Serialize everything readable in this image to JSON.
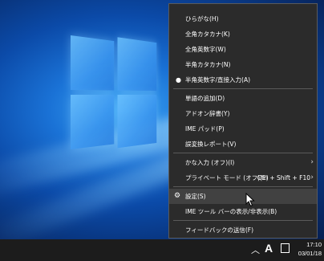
{
  "menu": {
    "items": [
      {
        "label": "ひらがな(H)"
      },
      {
        "label": "全角カタカナ(K)"
      },
      {
        "label": "全角英数字(W)"
      },
      {
        "label": "半角カタカナ(N)"
      },
      {
        "label": "半角英数字/直接入力(A)",
        "selected": true
      },
      {
        "label": "単語の追加(D)"
      },
      {
        "label": "アドオン辞書(Y)"
      },
      {
        "label": "IME パッド(P)"
      },
      {
        "label": "誤変換レポート(V)"
      },
      {
        "label": "かな入力 (オフ)(I)"
      },
      {
        "label": "プライベート モード (オフ)(E)",
        "shortcut": "Ctrl + Shift + F10"
      },
      {
        "label": "設定(S)",
        "icon": "gear-icon",
        "highlighted": true
      },
      {
        "label": "IME ツール バーの表示/非表示(B)"
      },
      {
        "label": "フィードバックの送信(F)"
      }
    ]
  },
  "taskbar": {
    "tray_mode": "A",
    "time": "17:10",
    "date": "03/01/18"
  },
  "colors": {
    "menu_background": "#2b2b2b",
    "menu_hover": "#414141",
    "menu_border": "#5a5a5a",
    "taskbar": "#1c1c1c"
  }
}
